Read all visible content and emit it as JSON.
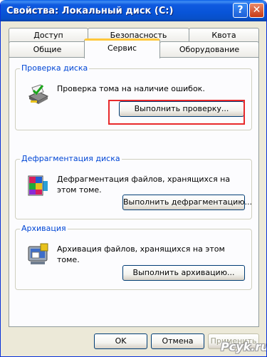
{
  "window": {
    "title": "Свойства: Локальный диск (C:)",
    "help_label": "?",
    "close_label": "✕"
  },
  "tabs": {
    "row1": [
      {
        "label": "Доступ"
      },
      {
        "label": "Безопасность"
      },
      {
        "label": "Квота"
      }
    ],
    "row2": [
      {
        "label": "Общие"
      },
      {
        "label": "Сервис",
        "selected": true
      },
      {
        "label": "Оборудование"
      }
    ]
  },
  "groups": {
    "check": {
      "title": "Проверка диска",
      "text": "Проверка тома на наличие ошибок.",
      "button": "Выполнить проверку...",
      "icon": "disk-check-icon"
    },
    "defrag": {
      "title": "Дефрагментация диска",
      "text": "Дефрагментация файлов, хранящихся на этом томе.",
      "button": "Выполнить дефрагментацию...",
      "icon": "defrag-icon"
    },
    "backup": {
      "title": "Архивация",
      "text": "Архивация файлов, хранящихся на этом томе.",
      "button": "Выполнить архивацию...",
      "icon": "backup-icon"
    }
  },
  "footer": {
    "ok": "OK",
    "cancel": "Отмена",
    "apply": "Применить"
  },
  "watermark": "Pcyk.ru",
  "colors": {
    "titlebar": "#0a5fe8",
    "dialog_bg": "#ece9d8",
    "group_title": "#0046d5",
    "highlight": "#e8292b",
    "active_tab_accent": "#ffc83c"
  }
}
